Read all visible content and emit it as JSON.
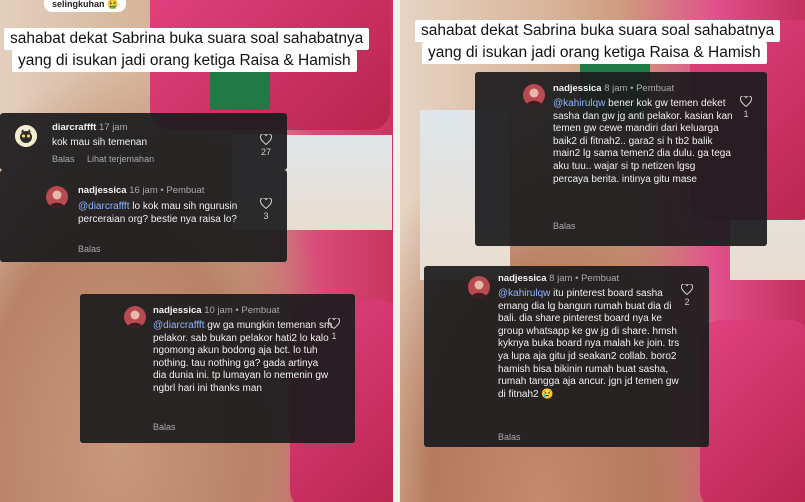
{
  "left": {
    "top_pill": "selingkuhan",
    "title_lines": [
      "sahabat dekat Sabrina buka suara soal sahabatnya",
      "yang di isukan jadi orang ketiga Raisa & Hamish"
    ],
    "comments": [
      {
        "username": "diarcraffft",
        "meta": "17 jam",
        "text": "kok mau sih temenan",
        "reply_label": "Balas",
        "translate_label": "Lihat terjemahan",
        "likes": "27"
      },
      {
        "username": "nadjessica",
        "meta": "16 jam • Pembuat",
        "mention": "@diarcraffft",
        "text": " lo kok mau sih ngurusin perceraian org? bestie nya raisa lo?",
        "reply_label": "Balas",
        "likes": "3"
      },
      {
        "username": "nadjessica",
        "meta": "10 jam • Pembuat",
        "mention": "@diarcraffft",
        "text": " gw ga mungkin temenan sm pelakor. sab bukan pelakor hati2 lo kalo ngomong akun bodong aja bct. lo tuh nothing. tau nothing ga? gada artinya dia dunia ini. tp lumayan lo nemenin gw ngbrl hari ini thanks man",
        "reply_label": "Balas",
        "likes": "1"
      }
    ]
  },
  "right": {
    "title_lines": [
      "sahabat dekat Sabrina buka suara soal sahabatnya",
      "yang di isukan jadi orang ketiga Raisa & Hamish"
    ],
    "comments": [
      {
        "username": "nadjessica",
        "meta": "8 jam • Pembuat",
        "mention": "@kahirulqw",
        "text": " bener kok gw temen deket sasha dan gw jg anti pelakor. kasian kan temen gw cewe mandiri dari keluarga baik2 di fitnah2.. gara2 si h tb2 balik main2 lg sama temen2 dia dulu. ga tega aku tuu.. wajar si tp netizen lgsg percaya berita. intinya gitu mase",
        "reply_label": "Balas",
        "likes": "1"
      },
      {
        "username": "nadjessica",
        "meta": "8 jam • Pembuat",
        "mention": "@kahirulqw",
        "text": " itu pinterest board sasha emang dia lg bangun rumah buat dia di bali. dia share pinterest board nya ke group whatsapp ke gw jg di share. hmsh kyknya buka board nya malah ke join. trs ya lupa aja gitu jd seakan2 collab. boro2 hamish bisa bikinin rumah buat sasha, rumah tangga aja ancur. jgn jd temen gw di fitnah2 😢",
        "reply_label": "Balas",
        "likes": "2"
      }
    ]
  },
  "colors": {
    "card_bg": "#1c1c1e",
    "mention": "#8fb4ff",
    "meta_text": "#a9a9ad",
    "title_bg": "#ffffff"
  }
}
